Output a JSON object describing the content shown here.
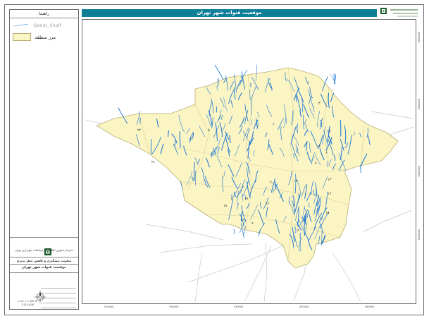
{
  "title": "موقعیت قنوات شهر تهران",
  "legend": {
    "heading": "راهنما",
    "items": [
      {
        "label": "Qanat_Shaft",
        "symbol": "line",
        "color": "#1f77d4"
      },
      {
        "label": "مرز منطقه",
        "symbol": "polygon",
        "color": "#fbf5c3"
      }
    ]
  },
  "logo_text": {
    "org": "سازمان فناوری اطلاعات و ارتباطات شهرداری تهران",
    "deputy": "معاونت پیشگیری و کاهش خطر پذیری",
    "map_name": "موقعیت قنوات شهر تهران"
  },
  "scale": {
    "unit_line": "1 cm = 1,100 m",
    "ratio": "1:110,000"
  },
  "coordinates": {
    "x_ticks": [
      "520000",
      "530000",
      "540000",
      "550000",
      "560000"
    ],
    "y_ticks": [
      "3960000",
      "3950000",
      "3940000",
      "3930000"
    ]
  },
  "region_labels": [
    "۱",
    "۲",
    "۳",
    "۴",
    "۵",
    "۶",
    "۷",
    "۸",
    "۹",
    "۱۰",
    "۱۱",
    "۱۲",
    "۱۳",
    "۱۴",
    "۱۵",
    "۱۶",
    "۱۷",
    "۱۸",
    "۱۹",
    "۲۰",
    "۲۱",
    "۲۲"
  ],
  "colors": {
    "title_bar": "#0f7f98",
    "map_fill": "#fbf5c3",
    "boundary": "#b8ae73",
    "qanat": "#1f77d4",
    "roads": "#c8c8c8"
  }
}
